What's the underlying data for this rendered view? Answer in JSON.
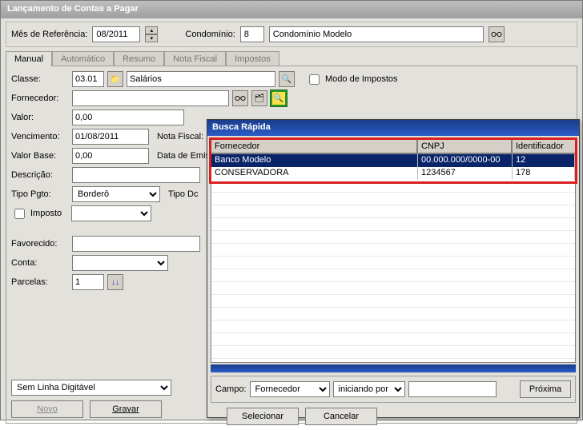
{
  "window_title": "Lançamento de Contas a Pagar",
  "ref": {
    "mes_label": "Mês de Referência:",
    "mes_value": "08/2011",
    "cond_label": "Condomínio:",
    "cond_code": "8",
    "cond_name": "Condomínio Modelo"
  },
  "tabs": [
    "Manual",
    "Automático",
    "Resumo",
    "Nota Fiscal",
    "Impostos"
  ],
  "active_tab": 0,
  "form": {
    "classe_label": "Classe:",
    "classe_code": "03.01",
    "classe_desc": "Salários",
    "fornecedor_label": "Fornecedor:",
    "fornecedor_value": "",
    "valor_label": "Valor:",
    "valor_value": "0,00",
    "venc_label": "Vencimento:",
    "venc_value": "01/08/2011",
    "nota_fiscal_label": "Nota Fiscal:",
    "valor_base_label": "Valor Base:",
    "valor_base_value": "0,00",
    "data_emissao_label": "Data de Emis",
    "descricao_label": "Descrição:",
    "descricao_value": "",
    "tipo_pgto_label": "Tipo Pgto:",
    "tipo_pgto_value": "Borderô",
    "tipo_doc_label": "Tipo Dc",
    "modo_impostos_label": "Modo de Impostos",
    "imposto_chk_label": "Imposto",
    "favorecido_label": "Favorecido:",
    "favorecido_value": "",
    "conta_label": "Conta:",
    "conta_value": "",
    "parcelas_label": "Parcelas:",
    "parcelas_value": "1",
    "linha_digit": "Sem Linha Digitável",
    "btn_novo": "Novo",
    "btn_gravar": "Gravar"
  },
  "popup": {
    "title": "Busca Rápida",
    "headers": [
      "Fornecedor",
      "CNPJ",
      "Identificador"
    ],
    "rows": [
      {
        "fornecedor": "Banco Modelo",
        "cnpj": "00.000.000/0000-00",
        "ident": "12",
        "selected": true
      },
      {
        "fornecedor": "CONSERVADORA",
        "cnpj": "1234567",
        "ident": "178",
        "selected": false
      }
    ],
    "campo_label": "Campo:",
    "campo_value": "Fornecedor",
    "modo_value": "iniciando por",
    "search_value": "",
    "btn_proxima": "Próxima",
    "btn_selecionar": "Selecionar",
    "btn_cancelar": "Cancelar"
  }
}
